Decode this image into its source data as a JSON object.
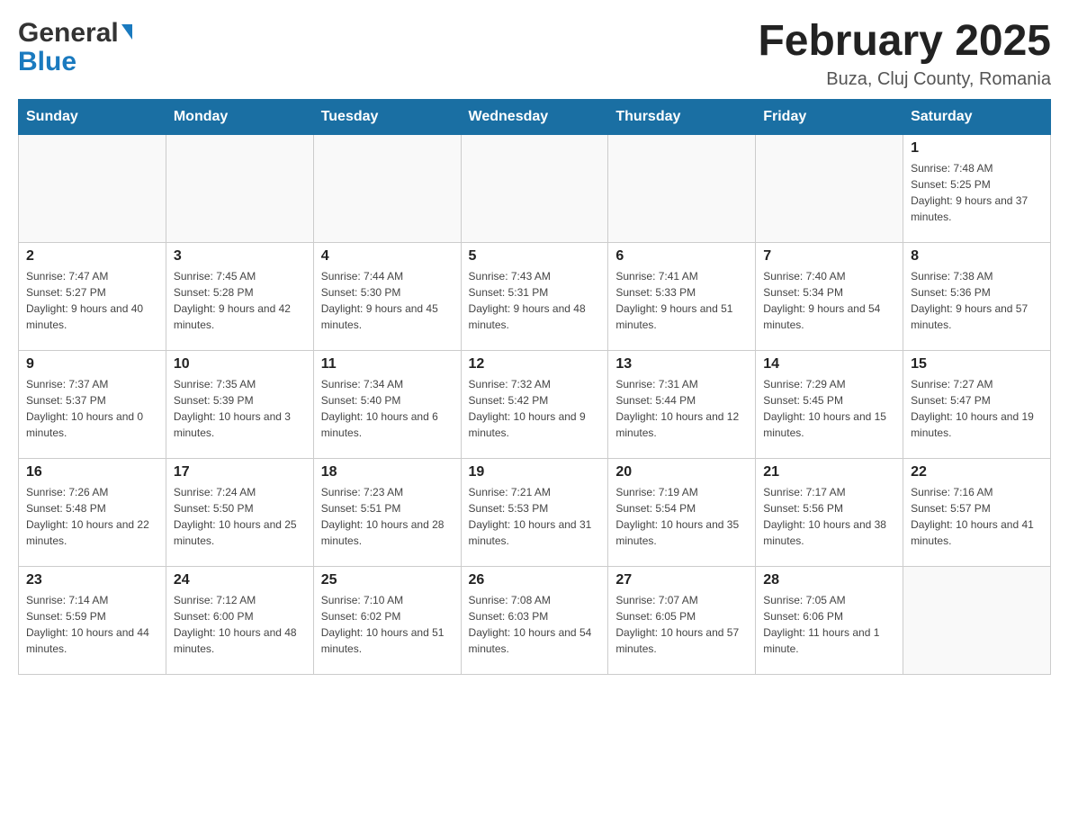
{
  "header": {
    "month_year": "February 2025",
    "location": "Buza, Cluj County, Romania",
    "logo_general": "General",
    "logo_blue": "Blue"
  },
  "days_of_week": [
    "Sunday",
    "Monday",
    "Tuesday",
    "Wednesday",
    "Thursday",
    "Friday",
    "Saturday"
  ],
  "weeks": [
    {
      "days": [
        {
          "number": "",
          "info": "",
          "empty": true
        },
        {
          "number": "",
          "info": "",
          "empty": true
        },
        {
          "number": "",
          "info": "",
          "empty": true
        },
        {
          "number": "",
          "info": "",
          "empty": true
        },
        {
          "number": "",
          "info": "",
          "empty": true
        },
        {
          "number": "",
          "info": "",
          "empty": true
        },
        {
          "number": "1",
          "info": "Sunrise: 7:48 AM\nSunset: 5:25 PM\nDaylight: 9 hours and 37 minutes.",
          "empty": false
        }
      ]
    },
    {
      "days": [
        {
          "number": "2",
          "info": "Sunrise: 7:47 AM\nSunset: 5:27 PM\nDaylight: 9 hours and 40 minutes.",
          "empty": false
        },
        {
          "number": "3",
          "info": "Sunrise: 7:45 AM\nSunset: 5:28 PM\nDaylight: 9 hours and 42 minutes.",
          "empty": false
        },
        {
          "number": "4",
          "info": "Sunrise: 7:44 AM\nSunset: 5:30 PM\nDaylight: 9 hours and 45 minutes.",
          "empty": false
        },
        {
          "number": "5",
          "info": "Sunrise: 7:43 AM\nSunset: 5:31 PM\nDaylight: 9 hours and 48 minutes.",
          "empty": false
        },
        {
          "number": "6",
          "info": "Sunrise: 7:41 AM\nSunset: 5:33 PM\nDaylight: 9 hours and 51 minutes.",
          "empty": false
        },
        {
          "number": "7",
          "info": "Sunrise: 7:40 AM\nSunset: 5:34 PM\nDaylight: 9 hours and 54 minutes.",
          "empty": false
        },
        {
          "number": "8",
          "info": "Sunrise: 7:38 AM\nSunset: 5:36 PM\nDaylight: 9 hours and 57 minutes.",
          "empty": false
        }
      ]
    },
    {
      "days": [
        {
          "number": "9",
          "info": "Sunrise: 7:37 AM\nSunset: 5:37 PM\nDaylight: 10 hours and 0 minutes.",
          "empty": false
        },
        {
          "number": "10",
          "info": "Sunrise: 7:35 AM\nSunset: 5:39 PM\nDaylight: 10 hours and 3 minutes.",
          "empty": false
        },
        {
          "number": "11",
          "info": "Sunrise: 7:34 AM\nSunset: 5:40 PM\nDaylight: 10 hours and 6 minutes.",
          "empty": false
        },
        {
          "number": "12",
          "info": "Sunrise: 7:32 AM\nSunset: 5:42 PM\nDaylight: 10 hours and 9 minutes.",
          "empty": false
        },
        {
          "number": "13",
          "info": "Sunrise: 7:31 AM\nSunset: 5:44 PM\nDaylight: 10 hours and 12 minutes.",
          "empty": false
        },
        {
          "number": "14",
          "info": "Sunrise: 7:29 AM\nSunset: 5:45 PM\nDaylight: 10 hours and 15 minutes.",
          "empty": false
        },
        {
          "number": "15",
          "info": "Sunrise: 7:27 AM\nSunset: 5:47 PM\nDaylight: 10 hours and 19 minutes.",
          "empty": false
        }
      ]
    },
    {
      "days": [
        {
          "number": "16",
          "info": "Sunrise: 7:26 AM\nSunset: 5:48 PM\nDaylight: 10 hours and 22 minutes.",
          "empty": false
        },
        {
          "number": "17",
          "info": "Sunrise: 7:24 AM\nSunset: 5:50 PM\nDaylight: 10 hours and 25 minutes.",
          "empty": false
        },
        {
          "number": "18",
          "info": "Sunrise: 7:23 AM\nSunset: 5:51 PM\nDaylight: 10 hours and 28 minutes.",
          "empty": false
        },
        {
          "number": "19",
          "info": "Sunrise: 7:21 AM\nSunset: 5:53 PM\nDaylight: 10 hours and 31 minutes.",
          "empty": false
        },
        {
          "number": "20",
          "info": "Sunrise: 7:19 AM\nSunset: 5:54 PM\nDaylight: 10 hours and 35 minutes.",
          "empty": false
        },
        {
          "number": "21",
          "info": "Sunrise: 7:17 AM\nSunset: 5:56 PM\nDaylight: 10 hours and 38 minutes.",
          "empty": false
        },
        {
          "number": "22",
          "info": "Sunrise: 7:16 AM\nSunset: 5:57 PM\nDaylight: 10 hours and 41 minutes.",
          "empty": false
        }
      ]
    },
    {
      "days": [
        {
          "number": "23",
          "info": "Sunrise: 7:14 AM\nSunset: 5:59 PM\nDaylight: 10 hours and 44 minutes.",
          "empty": false
        },
        {
          "number": "24",
          "info": "Sunrise: 7:12 AM\nSunset: 6:00 PM\nDaylight: 10 hours and 48 minutes.",
          "empty": false
        },
        {
          "number": "25",
          "info": "Sunrise: 7:10 AM\nSunset: 6:02 PM\nDaylight: 10 hours and 51 minutes.",
          "empty": false
        },
        {
          "number": "26",
          "info": "Sunrise: 7:08 AM\nSunset: 6:03 PM\nDaylight: 10 hours and 54 minutes.",
          "empty": false
        },
        {
          "number": "27",
          "info": "Sunrise: 7:07 AM\nSunset: 6:05 PM\nDaylight: 10 hours and 57 minutes.",
          "empty": false
        },
        {
          "number": "28",
          "info": "Sunrise: 7:05 AM\nSunset: 6:06 PM\nDaylight: 11 hours and 1 minute.",
          "empty": false
        },
        {
          "number": "",
          "info": "",
          "empty": true
        }
      ]
    }
  ]
}
